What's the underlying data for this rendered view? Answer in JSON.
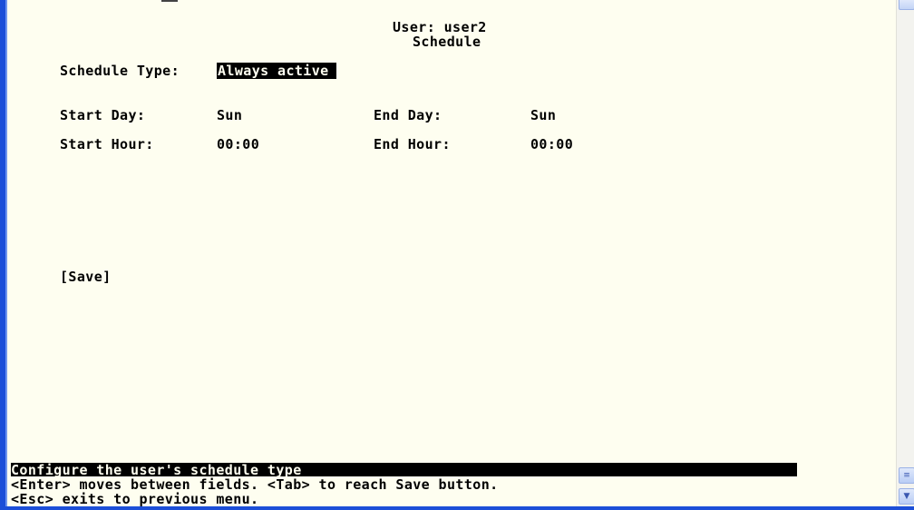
{
  "header": {
    "user_line": "User: user2",
    "title": "Schedule"
  },
  "form": {
    "schedule_type_label": "Schedule Type:",
    "schedule_type_value": "Always active",
    "start_day_label": "Start Day:",
    "start_day_value": "Sun",
    "end_day_label": "End Day:",
    "end_day_value": "Sun",
    "start_hour_label": "Start Hour:",
    "start_hour_value": "00:00",
    "end_hour_label": "End Hour:",
    "end_hour_value": "00:00",
    "save_label": "[Save]"
  },
  "status": {
    "description": "Configure the user's schedule type",
    "help_line1": "<Enter> moves between fields. <Tab> to reach Save button.",
    "help_line2": "<Esc> exits to previous menu."
  },
  "scrollbar": {
    "up_icon": "scroll-up-icon",
    "down_icon": "scroll-down-icon"
  },
  "colors": {
    "background": "#fefef0",
    "text": "#000000",
    "frame": "#1c4fd8"
  }
}
